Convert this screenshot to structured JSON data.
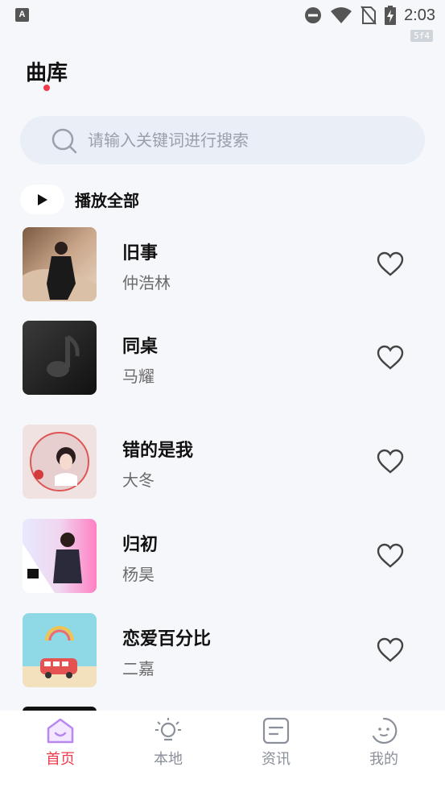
{
  "status_bar": {
    "app_icon_letter": "A",
    "time": "2:03",
    "badge": "5f4"
  },
  "header": {
    "title": "曲库"
  },
  "search": {
    "placeholder": "请输入关键词进行搜索"
  },
  "play_all": {
    "label": "播放全部"
  },
  "songs": [
    {
      "title": "旧事",
      "artist": "仲浩林"
    },
    {
      "title": "同桌",
      "artist": "马耀"
    },
    {
      "title": "错的是我",
      "artist": "大冬"
    },
    {
      "title": "归初",
      "artist": "杨昊"
    },
    {
      "title": "恋爱百分比",
      "artist": "二嘉"
    }
  ],
  "bottom_nav": [
    {
      "label": "首页",
      "icon": "home-icon",
      "active": true
    },
    {
      "label": "本地",
      "icon": "bulb-icon",
      "active": false
    },
    {
      "label": "资讯",
      "icon": "news-icon",
      "active": false
    },
    {
      "label": "我的",
      "icon": "face-icon",
      "active": false
    }
  ],
  "colors": {
    "accent": "#f03a4b",
    "nav_active_icon": "#b887f0",
    "search_bg": "#eaeef6",
    "background": "#f6f7fa"
  }
}
